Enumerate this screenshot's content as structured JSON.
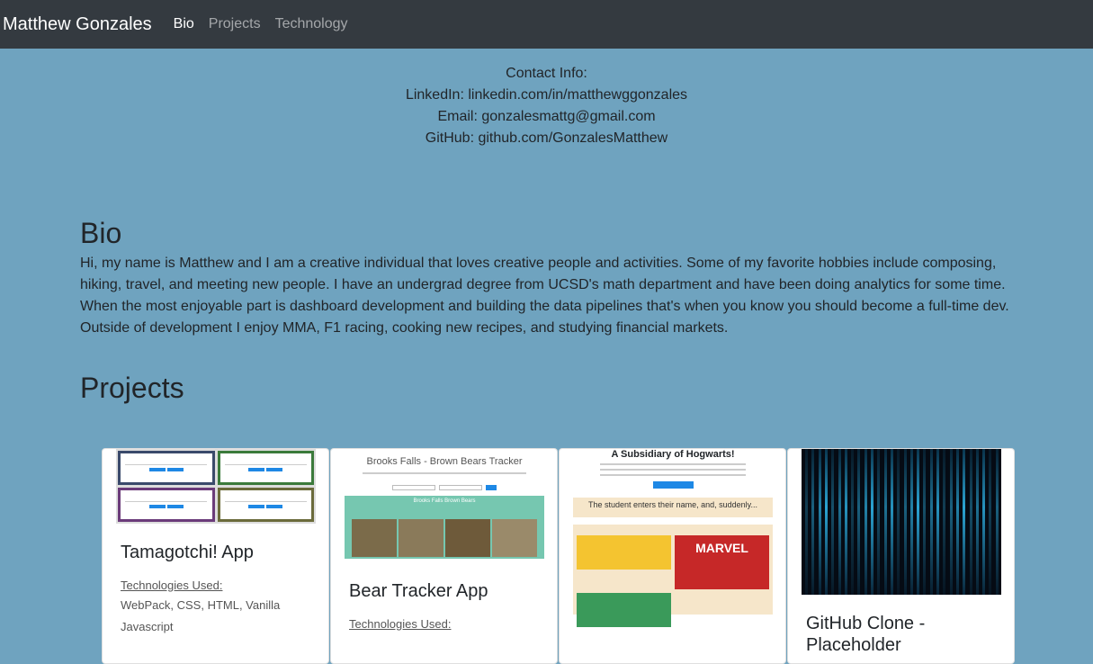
{
  "navbar": {
    "brand": "Matthew Gonzales",
    "links": [
      "Bio",
      "Projects",
      "Technology"
    ]
  },
  "contact": {
    "heading": "Contact Info:",
    "linkedin": "LinkedIn: linkedin.com/in/matthewggonzales",
    "email": "Email: gonzalesmattg@gmail.com",
    "github": "GitHub: github.com/GonzalesMatthew"
  },
  "bio": {
    "heading": "Bio",
    "text": "Hi, my name is Matthew and I am a creative individual that loves creative people and activities. Some of my favorite hobbies include composing, hiking, travel, and meeting new people. I have an undergrad degree from UCSD's math department and have been doing analytics for some time. When the most enjoyable part is dashboard development and building the data pipelines that's when you know you should become a full-time dev. Outside of development I enjoy MMA, F1 racing, cooking new recipes, and studying financial markets."
  },
  "projects": {
    "heading": "Projects",
    "cards": [
      {
        "title": "Tamagotchi! App",
        "tech_label": "Technologies Used:",
        "tech": "WebPack, CSS, HTML, Vanilla Javascript"
      },
      {
        "title": "Bear Tracker App",
        "tech_label": "Technologies Used:",
        "tech": "",
        "thumb_title": "Brooks Falls - Brown Bears Tracker",
        "thumb_sub": "Brooks Falls Brown Bears"
      },
      {
        "title": "",
        "thumb_title": "A Subsidiary of Hogwarts!",
        "thumb_caption": "The student enters their name, and, suddenly...",
        "thumb_logo": "MARVEL"
      },
      {
        "title": "GitHub Clone - Placeholder"
      }
    ]
  },
  "colors": {
    "navbar_bg": "#343a40",
    "page_bg": "#6fa3bf",
    "card_bg": "#ffffff"
  }
}
